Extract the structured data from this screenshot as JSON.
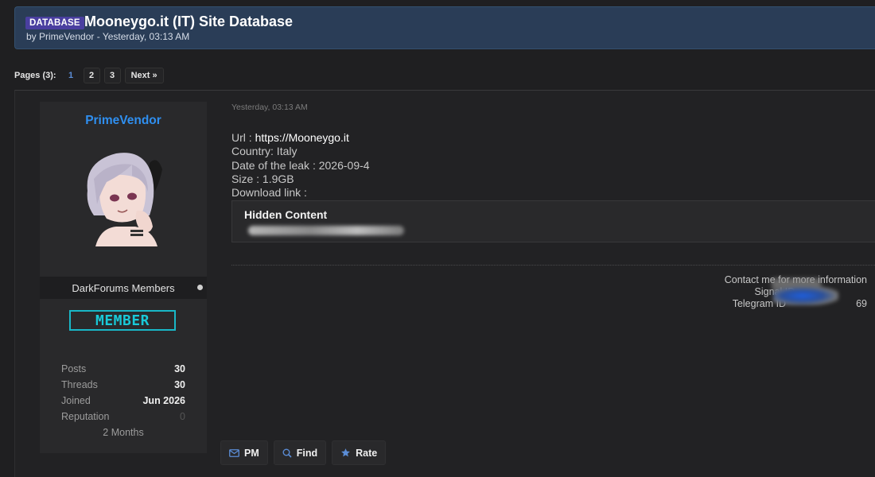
{
  "thread": {
    "prefix": "DATABASE",
    "title": "Mooneygo.it (IT) Site Database",
    "meta": "by PrimeVendor - Yesterday, 03:13 AM"
  },
  "pagination": {
    "label": "Pages (3):",
    "pages": [
      "1",
      "2",
      "3"
    ],
    "current": "1",
    "next": "Next »"
  },
  "author": {
    "name": "PrimeVendor",
    "group": "DarkForums Members",
    "badge": "MEMBER",
    "stats": {
      "posts_label": "Posts",
      "posts": "30",
      "threads_label": "Threads",
      "threads": "30",
      "joined_label": "Joined",
      "joined": "Jun 2026",
      "reputation_label": "Reputation",
      "reputation": "0",
      "tenure": "2 Months"
    }
  },
  "post": {
    "date": "Yesterday, 03:13 AM",
    "url_label": "Url : ",
    "url": "https://Mooneygo.it",
    "country": "Country: Italy",
    "leak_date": "Date of the leak : 2026-09-4",
    "size": "Size : 1.9GB",
    "download": "Download link :",
    "hidden_title": "Hidden Content",
    "contact_line1": "Contact me for more information",
    "contact_line2": "Signal ID =",
    "contact_line3": "Telegram ID",
    "contact_tail": "69"
  },
  "actions": {
    "pm": "PM",
    "find": "Find",
    "rate": "Rate"
  },
  "colors": {
    "accent_blue": "#2f8ff0",
    "header_bg": "#2a3d57",
    "badge_cyan": "#19b7c7",
    "prefix_purple": "#4a3fa0"
  }
}
